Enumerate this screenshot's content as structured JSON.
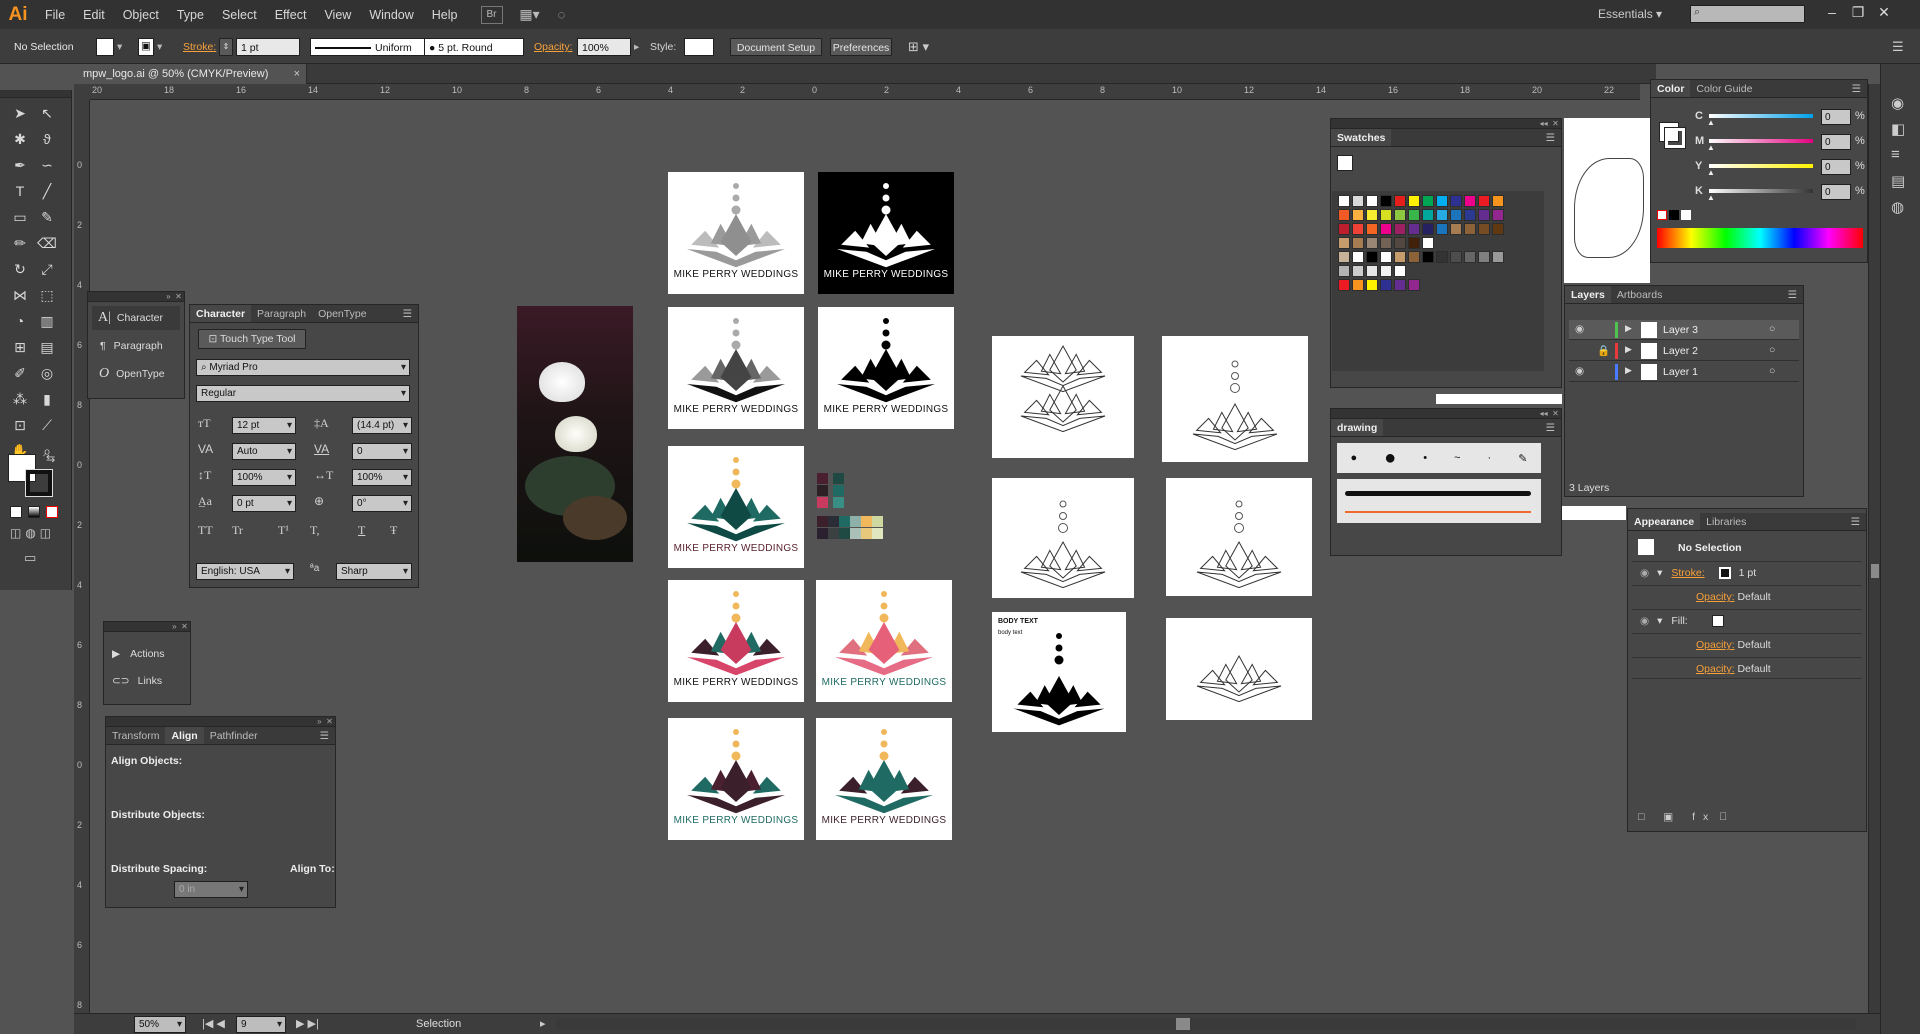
{
  "menu": {
    "logo": "Ai",
    "items": [
      "File",
      "Edit",
      "Object",
      "Type",
      "Select",
      "Effect",
      "View",
      "Window",
      "Help"
    ],
    "br_label": "Br",
    "workspace": "Essentials"
  },
  "control": {
    "selection": "No Selection",
    "stroke_label": "Stroke:",
    "stroke_weight": "1 pt",
    "stroke_profile": "Uniform",
    "brush": "5 pt. Round",
    "opacity_label": "Opacity:",
    "opacity": "100%",
    "style_label": "Style:",
    "doc_setup": "Document Setup",
    "preferences": "Preferences"
  },
  "document": {
    "tab": "mpw_logo.ai @ 50% (CMYK/Preview)",
    "close": "×"
  },
  "ruler": {
    "h": [
      "20",
      "18",
      "16",
      "14",
      "12",
      "10",
      "8",
      "6",
      "4",
      "2",
      "0",
      "2",
      "4",
      "6",
      "8",
      "10",
      "12",
      "14",
      "16",
      "18",
      "20",
      "22"
    ],
    "v": [
      "0",
      "2",
      "4",
      "6",
      "8",
      "0",
      "2",
      "4",
      "6",
      "8",
      "0",
      "2",
      "4",
      "6",
      "8"
    ]
  },
  "character_mini": {
    "items": [
      "Character",
      "Paragraph",
      "OpenType"
    ]
  },
  "character": {
    "tabs": [
      "Character",
      "Paragraph",
      "OpenType"
    ],
    "touch": "Touch Type Tool",
    "font": "Myriad Pro",
    "style": "Regular",
    "size": "12 pt",
    "leading": "(14.4 pt)",
    "kerning": "Auto",
    "tracking": "0",
    "vscale": "100%",
    "hscale": "100%",
    "baseline": "0 pt",
    "rotation": "0°",
    "language": "English: USA",
    "aa": "Sharp",
    "aa_label": "aa",
    "glyphs": [
      "TT",
      "Tr",
      "T¹",
      "T,",
      "T",
      "Ŧ"
    ]
  },
  "actions": {
    "items": [
      "Actions",
      "Links"
    ]
  },
  "align": {
    "tabs": [
      "Transform",
      "Align",
      "Pathfinder"
    ],
    "align_objects": "Align Objects:",
    "distribute_objects": "Distribute Objects:",
    "distribute_spacing": "Distribute Spacing:",
    "align_to": "Align To:",
    "spacing_value": "0 in"
  },
  "swatches": {
    "title": "Swatches"
  },
  "drawing": {
    "title": "drawing"
  },
  "color": {
    "tabs": [
      "Color",
      "Color Guide"
    ],
    "channels": [
      {
        "name": "C",
        "value": "0",
        "color": "#00a0e9"
      },
      {
        "name": "M",
        "value": "0",
        "color": "#e4007f"
      },
      {
        "name": "Y",
        "value": "0",
        "color": "#fff100"
      },
      {
        "name": "K",
        "value": "0",
        "color": "#333333"
      }
    ],
    "pct": "%"
  },
  "layers": {
    "tabs": [
      "Layers",
      "Artboards"
    ],
    "rows": [
      {
        "name": "Layer 3",
        "color": "#4fc24f",
        "locked": false
      },
      {
        "name": "Layer 2",
        "color": "#e83a3a",
        "locked": true
      },
      {
        "name": "Layer 1",
        "color": "#4a7bff",
        "locked": false
      }
    ],
    "count": "3 Layers"
  },
  "appearance": {
    "tabs": [
      "Appearance",
      "Libraries"
    ],
    "selection": "No Selection",
    "stroke": "Stroke:",
    "stroke_val": "1 pt",
    "opacity": "Opacity:",
    "default": "Default",
    "fill": "Fill:"
  },
  "artwork": {
    "brand": "MIKE PERRY WEDDINGS",
    "body_head": "BODY TEXT",
    "body_sub": "body text"
  },
  "status": {
    "zoom": "50%",
    "page": "9",
    "tool": "Selection"
  }
}
